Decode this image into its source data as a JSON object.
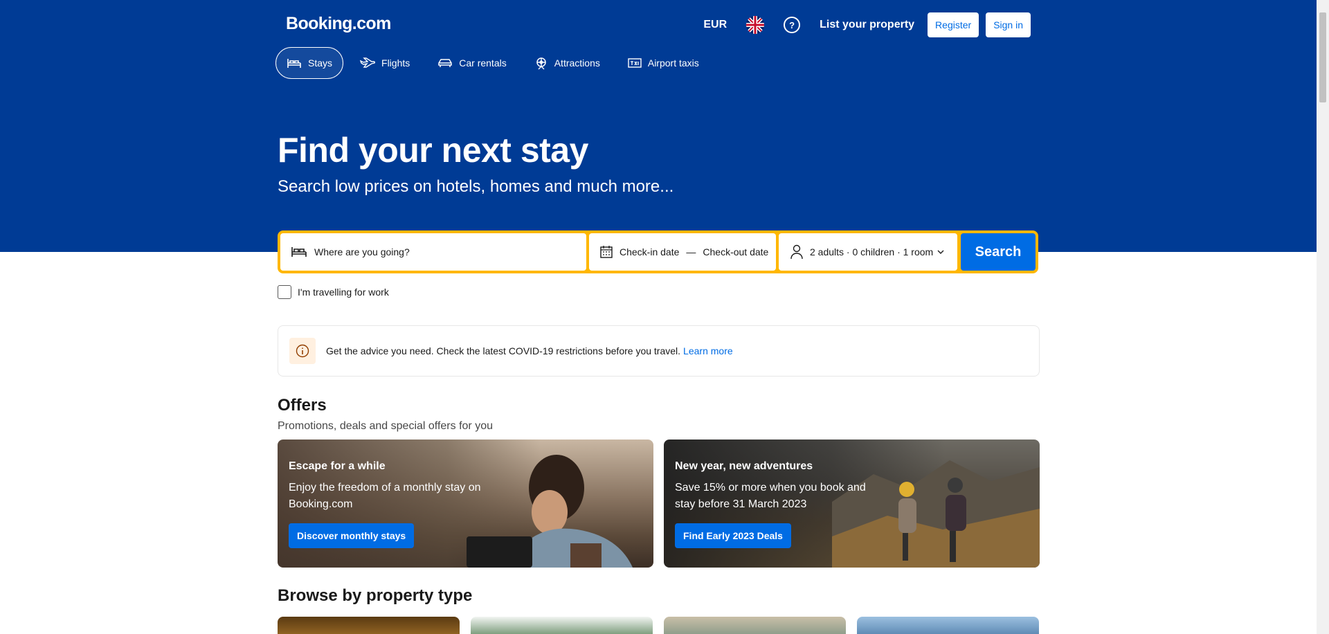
{
  "header": {
    "logo": "Booking.com",
    "currency": "EUR",
    "list_property": "List your property",
    "register": "Register",
    "sign_in": "Sign in"
  },
  "nav": [
    {
      "label": "Stays",
      "icon": "bed-icon"
    },
    {
      "label": "Flights",
      "icon": "plane-icon"
    },
    {
      "label": "Car rentals",
      "icon": "car-icon"
    },
    {
      "label": "Attractions",
      "icon": "attractions-icon"
    },
    {
      "label": "Airport taxis",
      "icon": "taxi-icon"
    }
  ],
  "hero": {
    "title": "Find your next stay",
    "subtitle": "Search low prices on hotels, homes and much more..."
  },
  "search": {
    "destination_placeholder": "Where are you going?",
    "checkin": "Check-in date",
    "separator": "—",
    "checkout": "Check-out date",
    "occupancy": "2 adults · 0 children · 1 room",
    "button": "Search",
    "work_travel": "I'm travelling for work"
  },
  "banner": {
    "text": "Get the advice you need. Check the latest COVID-19 restrictions before you travel.",
    "link": "Learn more"
  },
  "offers": {
    "title": "Offers",
    "subtitle": "Promotions, deals and special offers for you",
    "cards": [
      {
        "title": "Escape for a while",
        "desc": "Enjoy the freedom of a monthly stay on Booking.com",
        "button": "Discover monthly stays"
      },
      {
        "title": "New year, new adventures",
        "desc": "Save 15% or more when you book and stay before 31 March 2023",
        "button": "Find Early 2023 Deals"
      }
    ]
  },
  "browse": {
    "title": "Browse by property type"
  },
  "colors": {
    "brand_blue": "#003b95",
    "action_blue": "#006ce4",
    "search_border": "#ffb700"
  }
}
